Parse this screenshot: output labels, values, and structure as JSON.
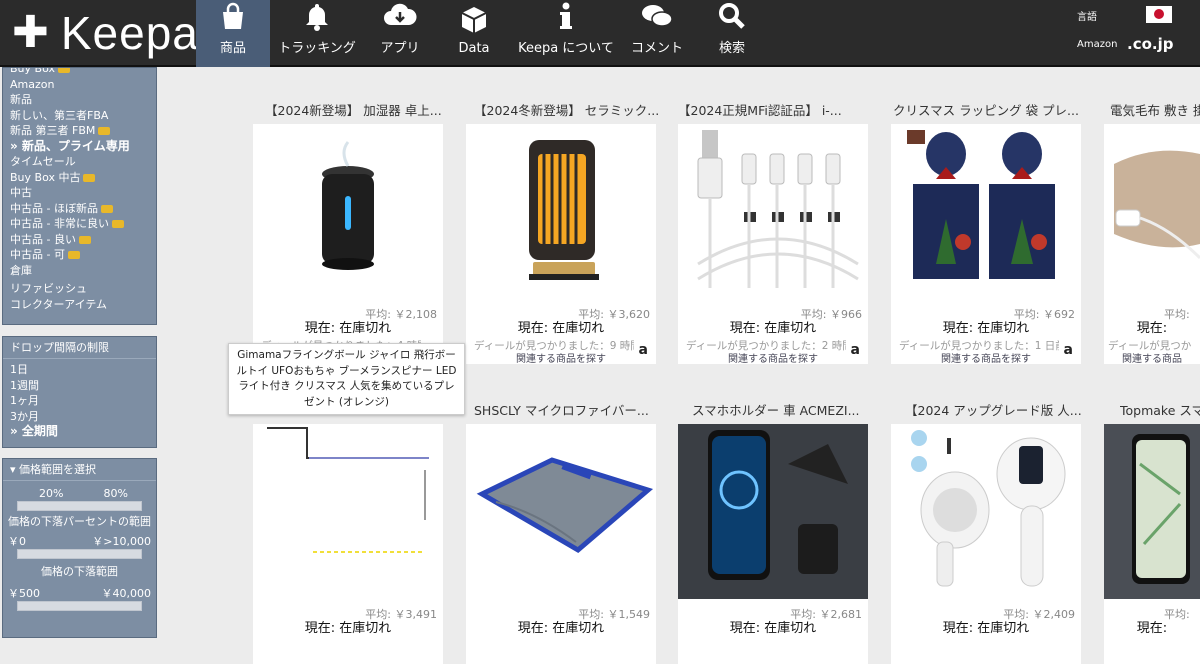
{
  "header": {
    "logo_text": "Keepa",
    "nav": [
      {
        "label": "商品",
        "icon": "shopping-bag-icon",
        "active": true
      },
      {
        "label": "トラッキング",
        "icon": "bell-icon"
      },
      {
        "label": "アプリ",
        "icon": "cloud-download-icon"
      },
      {
        "label": "Data",
        "icon": "cube-icon"
      },
      {
        "label": "Keepa について",
        "icon": "info-icon"
      },
      {
        "label": "コメント",
        "icon": "chat-icon"
      },
      {
        "label": "検索",
        "icon": "search-icon"
      }
    ],
    "language_label": "言語",
    "amazon_label": "Amazon",
    "domain": ".co.jp"
  },
  "sidebar": {
    "price_types": [
      {
        "label": "Buy Box",
        "truck": true
      },
      {
        "label": "Amazon"
      },
      {
        "label": "新品"
      },
      {
        "label": "新しい、第三者FBA"
      },
      {
        "label": "新品 第三者 FBM",
        "truck": true
      },
      {
        "label": "» 新品、プライム専用",
        "bold": true
      },
      {
        "label": "タイムセール"
      },
      {
        "label": "Buy Box 中古",
        "truck": true
      },
      {
        "label": "中古"
      },
      {
        "label": "中古品 - ほぼ新品",
        "truck": true
      },
      {
        "label": "中古品 - 非常に良い",
        "truck": true
      },
      {
        "label": "中古品 - 良い",
        "truck": true
      },
      {
        "label": "中古品 - 可",
        "truck": true
      },
      {
        "label": "倉庫"
      },
      {
        "label": "リファビッシュ"
      },
      {
        "label": "コレクターアイテム"
      }
    ],
    "drop_interval": {
      "title": "ドロップ間隔の制限",
      "options": [
        "1日",
        "1週間",
        "1ヶ月",
        "3か月",
        "» 全期間"
      ]
    },
    "price_range": {
      "title": "▾ 価格範囲を選択",
      "percent_min": "20%",
      "percent_max": "80%",
      "percent_label": "価格の下落パーセントの範囲",
      "drop_min": "￥0",
      "drop_max": "￥>10,000",
      "drop_label": "価格の下落範囲",
      "price_min": "￥500",
      "price_max": "￥40,000"
    }
  },
  "products": [
    {
      "title": "【2024新登場】 加湿器 卓上...",
      "avg": "平均: ￥2,108",
      "stock": "現在: 在庫切れ",
      "deal": "ディールが見つかりました：4 時間前",
      "related": "関連する商品を探す",
      "icon": "humidifier-image"
    },
    {
      "title": "【2024冬新登場】 セラミック...",
      "avg": "平均: ￥3,620",
      "stock": "現在: 在庫切れ",
      "deal": "ディールが見つかりました：9 時間前",
      "related": "関連する商品を探す",
      "icon": "heater-image"
    },
    {
      "title": "【2024正規MFi認証品】 i-...",
      "avg": "平均: ￥966",
      "stock": "現在: 在庫切れ",
      "deal": "ディールが見つかりました：2 時間前",
      "related": "関連する商品を探す",
      "icon": "cable-image"
    },
    {
      "title": "クリスマス ラッピング 袋 プレ...",
      "avg": "平均: ￥692",
      "stock": "現在: 在庫切れ",
      "deal": "ディールが見つかりました：1 日前",
      "related": "関連する商品を探す",
      "icon": "gift-bag-image"
    },
    {
      "title": "電気毛布 敷き 掛...",
      "avg": "平均:",
      "stock": "現在:",
      "deal": "ディールが見つか",
      "related": "関連する商品",
      "icon": "blanket-image"
    },
    {
      "title": "",
      "avg": "平均: ￥3,491",
      "stock": "現在: 在庫切れ",
      "deal": "",
      "related": "",
      "icon": "broken-image"
    },
    {
      "title": "SHSCLY マイクロファイバー...",
      "avg": "平均: ￥1,549",
      "stock": "現在: 在庫切れ",
      "deal": "",
      "related": "",
      "icon": "towel-image"
    },
    {
      "title": "スマホホルダー 車 ACMEZI...",
      "avg": "平均: ￥2,681",
      "stock": "現在: 在庫切れ",
      "deal": "",
      "related": "",
      "icon": "car-mount-image"
    },
    {
      "title": "【2024 アップグレード版 人...",
      "avg": "平均: ￥2,409",
      "stock": "現在: 在庫切れ",
      "deal": "",
      "related": "",
      "icon": "lint-remover-image"
    },
    {
      "title": "Topmake スマ",
      "avg": "平均:",
      "stock": "現在:",
      "deal": "",
      "related": "",
      "icon": "phone-holder-image"
    }
  ],
  "tooltip": "Gimamaフライングボール ジャイロ 飛行ボールトイ UFOおもちゃ ブーメランスピナー LEDライト付き クリスマス 人気を集めているプレゼント (オレンジ)",
  "colors": {
    "topbar": "#2b2b2b",
    "active_nav": "#4a5d77",
    "sidebar": "#7d8ea3"
  }
}
